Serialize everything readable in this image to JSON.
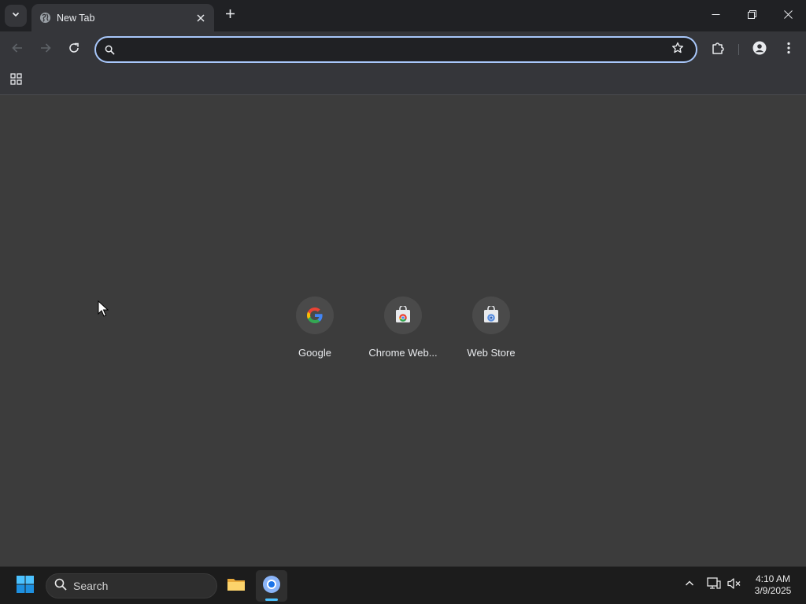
{
  "window": {
    "tab": {
      "title": "New Tab"
    }
  },
  "omnibox": {
    "value": "",
    "placeholder": ""
  },
  "shortcuts": [
    {
      "label": "Google"
    },
    {
      "label": "Chrome Web..."
    },
    {
      "label": "Web Store"
    }
  ],
  "taskbar": {
    "search_label": "Search",
    "clock_time": "4:10 AM",
    "clock_date": "3/9/2025"
  },
  "colors": {
    "focus_ring": "#a8c7fa",
    "toolbar": "#35363a",
    "content_bg": "#3c3c3c",
    "taskbar_accent": "#4cc2ff"
  },
  "icons": {
    "tab_strip": [
      "tab-search-icon",
      "globe-icon",
      "close-icon",
      "plus-icon",
      "minimize-icon",
      "restore-icon",
      "window-close-icon"
    ],
    "toolbar": [
      "back-arrow-icon",
      "forward-arrow-icon",
      "reload-icon",
      "search-icon",
      "star-icon",
      "puzzle-icon",
      "profile-icon",
      "more-vert-icon"
    ],
    "bookmarks": [
      "apps-grid-icon"
    ],
    "taskbar": [
      "windows-logo-icon",
      "search-icon",
      "folder-icon",
      "chrome-icon",
      "chevron-up-icon",
      "network-icon",
      "volume-muted-icon"
    ]
  }
}
